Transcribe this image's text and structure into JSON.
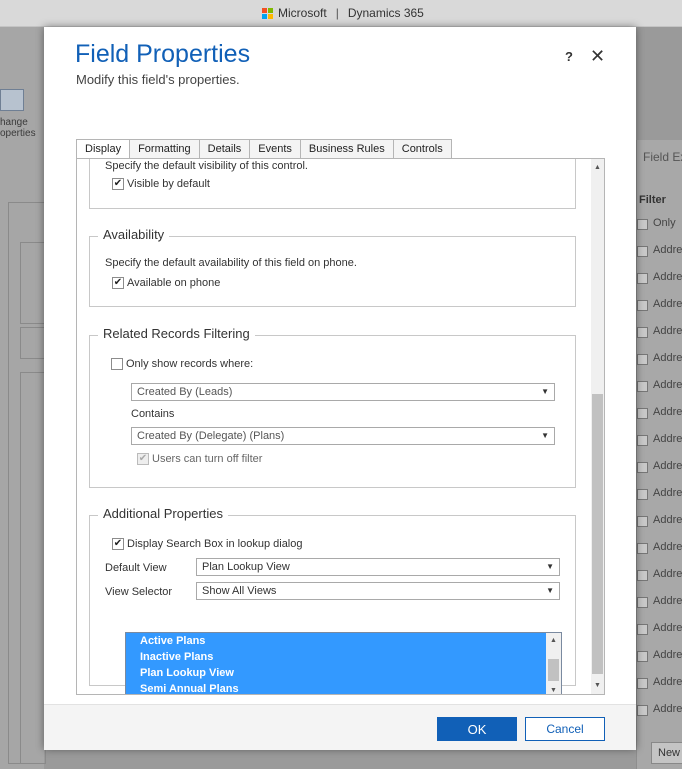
{
  "app": {
    "brand": "Microsoft",
    "product": "Dynamics 365"
  },
  "background": {
    "ribbon_label_line1": "hange",
    "ribbon_label_line2": "operties",
    "right_panel": {
      "header": "Field Ex",
      "filter_label": "Filter",
      "only_label": "Only",
      "items": [
        "Addre",
        "Addre",
        "Addre",
        "Addre",
        "Addre",
        "Addre",
        "Addre",
        "Addre",
        "Addre",
        "Addre",
        "Addre",
        "Addre",
        "Addre",
        "Addre",
        "Addre",
        "Addre",
        "Addre",
        "Addre"
      ],
      "new_button": "New"
    }
  },
  "dialog": {
    "title": "Field Properties",
    "subtitle": "Modify this field's properties.",
    "help": "?",
    "close": "✕",
    "tabs": [
      {
        "label": "Display",
        "active": true
      },
      {
        "label": "Formatting",
        "active": false
      },
      {
        "label": "Details",
        "active": false
      },
      {
        "label": "Events",
        "active": false
      },
      {
        "label": "Business Rules",
        "active": false
      },
      {
        "label": "Controls",
        "active": false
      }
    ],
    "visibility": {
      "description": "Specify the default visibility of this control.",
      "visible_by_default": {
        "label": "Visible by default",
        "checked": true
      }
    },
    "availability": {
      "legend": "Availability",
      "description": "Specify the default availability of this field on phone.",
      "available_on_phone": {
        "label": "Available on phone",
        "checked": true
      }
    },
    "related_records": {
      "legend": "Related Records Filtering",
      "only_show": {
        "label": "Only show records where:",
        "checked": false
      },
      "first_field": "Created By (Leads)",
      "contains_label": "Contains",
      "second_field": "Created By (Delegate) (Plans)",
      "users_can_turn_off": {
        "label": "Users can turn off filter",
        "checked": true
      }
    },
    "additional": {
      "legend": "Additional Properties",
      "display_search_box": {
        "label": "Display Search Box in lookup dialog",
        "checked": true
      },
      "default_view_label": "Default View",
      "default_view_value": "Plan Lookup View",
      "view_selector_label": "View Selector",
      "view_selector_value": "Show All Views",
      "views": [
        "Active Plans",
        "Inactive Plans",
        "Plan Lookup View",
        "Semi Annual Plans"
      ]
    },
    "ok_label": "OK",
    "cancel_label": "Cancel"
  },
  "colors": {
    "accent": "#1160b7",
    "selection": "#3399ff"
  },
  "icons": {
    "check": "✔",
    "caret": "▼",
    "up": "▲",
    "down": "▼"
  }
}
